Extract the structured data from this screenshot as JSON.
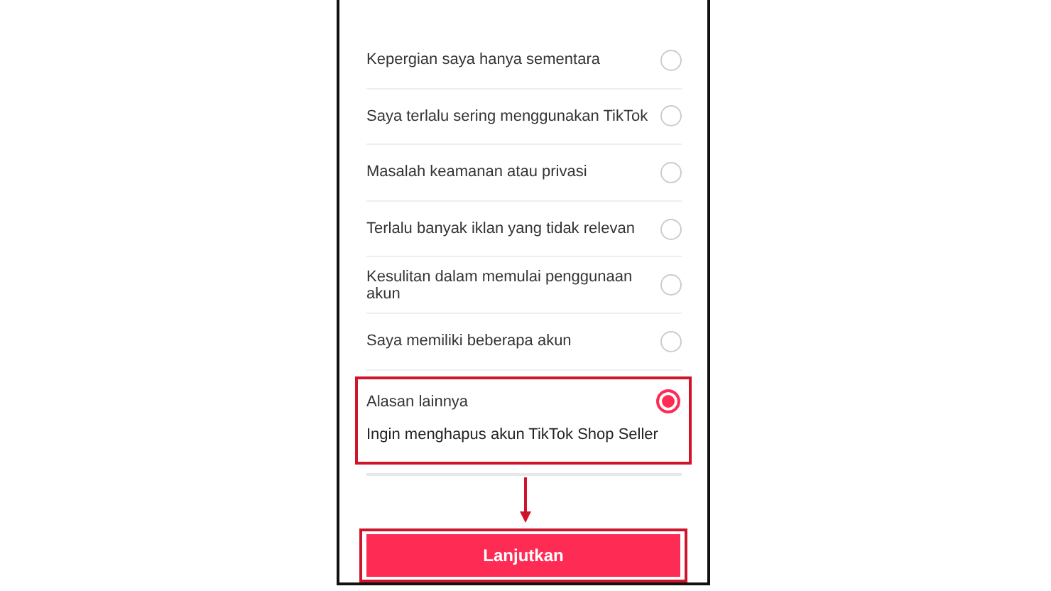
{
  "reasons": [
    {
      "label": "Kepergian saya hanya sementara",
      "selected": false
    },
    {
      "label": "Saya terlalu sering menggunakan TikTok",
      "selected": false
    },
    {
      "label": "Masalah keamanan atau privasi",
      "selected": false
    },
    {
      "label": "Terlalu banyak iklan yang tidak relevan",
      "selected": false
    },
    {
      "label": "Kesulitan dalam memulai penggunaan akun",
      "selected": false
    },
    {
      "label": "Saya memiliki beberapa akun",
      "selected": false
    }
  ],
  "other_reason": {
    "label": "Alasan lainnya",
    "selected": true,
    "detail": "Ingin menghapus akun TikTok Shop Seller"
  },
  "continue_button": "Lanjutkan"
}
